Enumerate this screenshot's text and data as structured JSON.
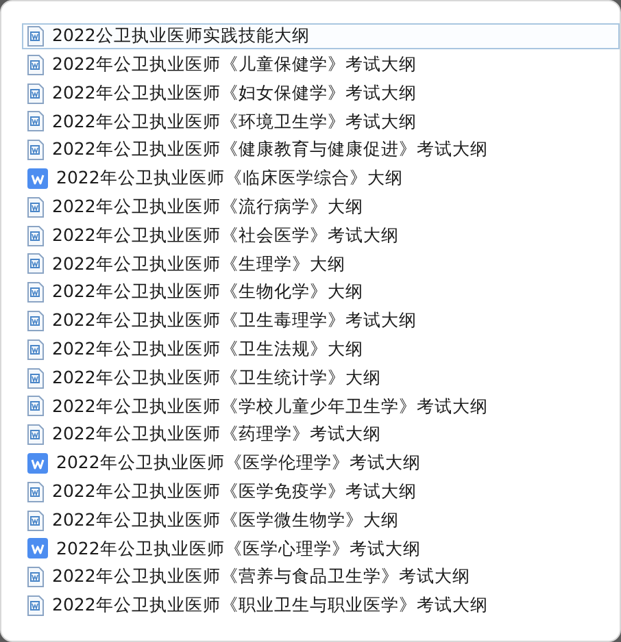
{
  "files": [
    {
      "name": "2022公卫执业医师实践技能大纲",
      "kind": "doc",
      "selected": true
    },
    {
      "name": "2022年公卫执业医师《儿童保健学》考试大纲",
      "kind": "doc",
      "selected": false
    },
    {
      "name": "2022年公卫执业医师《妇女保健学》考试大纲",
      "kind": "doc",
      "selected": false
    },
    {
      "name": "2022年公卫执业医师《环境卫生学》考试大纲",
      "kind": "doc",
      "selected": false
    },
    {
      "name": "2022年公卫执业医师《健康教育与健康促进》考试大纲",
      "kind": "doc",
      "selected": false
    },
    {
      "name": "2022年公卫执业医师《临床医学综合》大纲",
      "kind": "wps",
      "selected": false
    },
    {
      "name": "2022年公卫执业医师《流行病学》大纲",
      "kind": "doc",
      "selected": false
    },
    {
      "name": "2022年公卫执业医师《社会医学》考试大纲",
      "kind": "doc",
      "selected": false
    },
    {
      "name": "2022年公卫执业医师《生理学》大纲",
      "kind": "doc",
      "selected": false
    },
    {
      "name": "2022年公卫执业医师《生物化学》大纲",
      "kind": "doc",
      "selected": false
    },
    {
      "name": "2022年公卫执业医师《卫生毒理学》考试大纲",
      "kind": "doc",
      "selected": false
    },
    {
      "name": "2022年公卫执业医师《卫生法规》大纲",
      "kind": "doc",
      "selected": false
    },
    {
      "name": "2022年公卫执业医师《卫生统计学》大纲",
      "kind": "doc",
      "selected": false
    },
    {
      "name": "2022年公卫执业医师《学校儿童少年卫生学》考试大纲",
      "kind": "doc",
      "selected": false
    },
    {
      "name": "2022年公卫执业医师《药理学》考试大纲",
      "kind": "doc",
      "selected": false
    },
    {
      "name": "2022年公卫执业医师《医学伦理学》考试大纲",
      "kind": "wps",
      "selected": false
    },
    {
      "name": "2022年公卫执业医师《医学免疫学》考试大纲",
      "kind": "doc",
      "selected": false
    },
    {
      "name": "2022年公卫执业医师《医学微生物学》大纲",
      "kind": "doc",
      "selected": false
    },
    {
      "name": "2022年公卫执业医师《医学心理学》考试大纲",
      "kind": "wps",
      "selected": false
    },
    {
      "name": "2022年公卫执业医师《营养与食品卫生学》考试大纲",
      "kind": "doc",
      "selected": false
    },
    {
      "name": "2022年公卫执业医师《职业卫生与职业医学》考试大纲",
      "kind": "doc",
      "selected": false
    }
  ]
}
